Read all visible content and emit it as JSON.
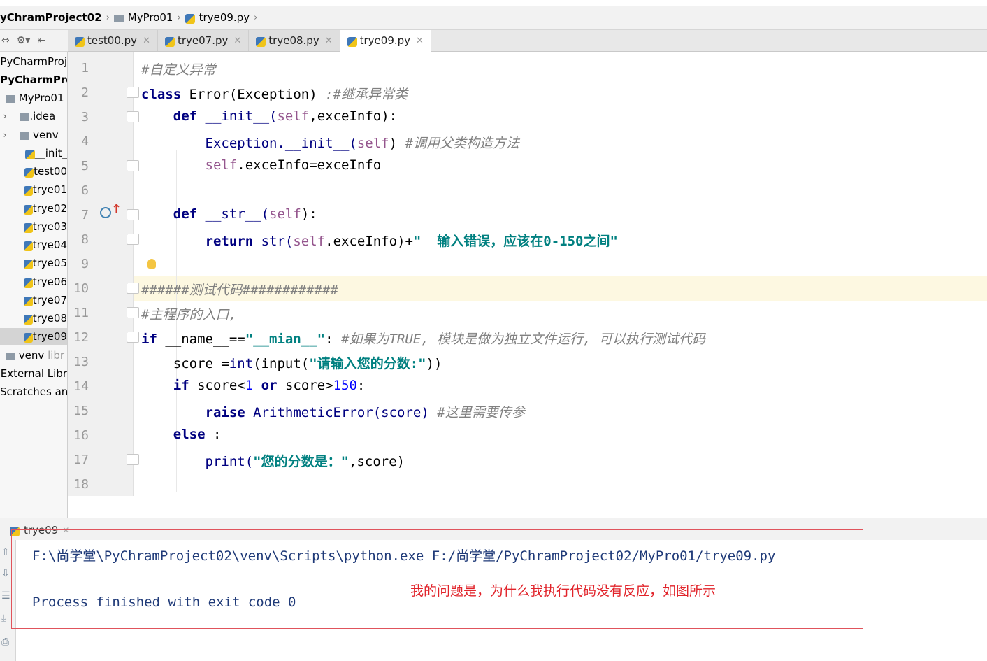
{
  "breadcrumb": {
    "project": "yChramProject02",
    "folder": "MyPro01",
    "file": "trye09.py"
  },
  "tabs": [
    {
      "label": "test00.py"
    },
    {
      "label": "trye07.py"
    },
    {
      "label": "trye08.py"
    },
    {
      "label": "trye09.py",
      "active": true
    }
  ],
  "project_tree": [
    {
      "label": "PyCharmProj"
    },
    {
      "label": "PyCharmPro"
    },
    {
      "label": "MyPro01"
    },
    {
      "label": ".idea"
    },
    {
      "label": "venv"
    },
    {
      "label": "__init_"
    },
    {
      "label": "test00"
    },
    {
      "label": "trye01"
    },
    {
      "label": "trye02"
    },
    {
      "label": "trye03"
    },
    {
      "label": "trye04"
    },
    {
      "label": "trye05"
    },
    {
      "label": "trye06"
    },
    {
      "label": "trye07"
    },
    {
      "label": "trye08"
    },
    {
      "label": "trye09"
    },
    {
      "label": "venv",
      "extra": "libr"
    },
    {
      "label": "External Libr"
    },
    {
      "label": "Scratches an"
    }
  ],
  "line_numbers": [
    "1",
    "2",
    "3",
    "4",
    "5",
    "6",
    "7",
    "8",
    "9",
    "10",
    "11",
    "12",
    "13",
    "14",
    "15",
    "16",
    "17",
    "18"
  ],
  "code": {
    "l1_comment": "#自定义异常",
    "l2_kw": "class",
    "l2_text": " Error(Exception) ",
    "l2_comment": ":#继承异常类",
    "l3_kw": "def",
    "l3_fn": " __init__(",
    "l3_self": "self",
    "l3_rest": ",exceInfo):",
    "l4_text": "Exception.__init__(",
    "l4_self": "self",
    "l4_close": ") ",
    "l4_comment": "#调用父类构造方法",
    "l5_self": "self",
    "l5_rest": ".exceInfo=exceInfo",
    "l7_kw": "def",
    "l7_fn": " __str__(",
    "l7_self": "self",
    "l7_close": "):",
    "l8_kw": "return",
    "l8_str": " str(",
    "l8_self": "self",
    "l8_rest": ".exceInfo)+",
    "l8_string": "\"  输入错误，应该在0-150之间\"",
    "l10_comment": "######测试代码############",
    "l11_comment": "#主程序的入口,",
    "l12_kw": "if",
    "l12_text": " __name__==",
    "l12_string": "\"__mian__\"",
    "l12_colon": ": ",
    "l12_comment": "#如果为TRUE, 模块是做为独立文件运行, 可以执行测试代码",
    "l13_text": "score =",
    "l13_int": "int",
    "l13_input": "(input(",
    "l13_string": "\"请输入您的分数:\"",
    "l13_close": "))",
    "l14_kw": "if",
    "l14_a": " score<",
    "l14_n1": "1",
    "l14_or": " or",
    "l14_b": " score>",
    "l14_n2": "150",
    "l14_c": ":",
    "l15_kw": "raise",
    "l15_text": " ArithmeticError(score) ",
    "l15_comment": "#这里需要传参",
    "l16_kw": "else",
    "l16_text": " :",
    "l17_fn": "print(",
    "l17_string": "\"您的分数是：\"",
    "l17_rest": ",score)"
  },
  "run": {
    "tab_label": "trye09",
    "cmd": "F:\\尚学堂\\PyChramProject02\\venv\\Scripts\\python.exe F:/尚学堂/PyChramProject02/MyPro01/trye09.py",
    "exit": "Process finished with exit code 0"
  },
  "annotation": "我的问题是，为什么我执行代码没有反应，如图所示",
  "colors": {
    "keyword": "#000080",
    "comment": "#808080",
    "string": "#008080",
    "self": "#94558d",
    "note": "#e1232a"
  }
}
